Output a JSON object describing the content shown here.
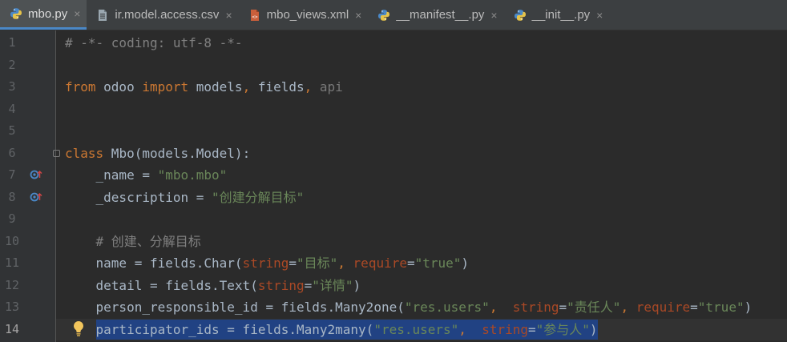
{
  "tabs": [
    {
      "label": "mbo.py",
      "icon": "python-file-icon",
      "active": true
    },
    {
      "label": "ir.model.access.csv",
      "icon": "csv-file-icon",
      "active": false
    },
    {
      "label": "mbo_views.xml",
      "icon": "xml-file-icon",
      "active": false
    },
    {
      "label": "__manifest__.py",
      "icon": "python-file-icon",
      "active": false
    },
    {
      "label": "__init__.py",
      "icon": "python-file-icon",
      "active": false
    }
  ],
  "tab_close_glyph": "×",
  "current_line": 14,
  "lines": [
    {
      "n": "1",
      "code": "# -*- coding: utf-8 -*-"
    },
    {
      "n": "2",
      "code": ""
    },
    {
      "n": "3",
      "code": "from odoo import models, fields, api"
    },
    {
      "n": "4",
      "code": ""
    },
    {
      "n": "5",
      "code": ""
    },
    {
      "n": "6",
      "code": "class Mbo(models.Model):"
    },
    {
      "n": "7",
      "code": "    _name = \"mbo.mbo\""
    },
    {
      "n": "8",
      "code": "    _description = \"创建分解目标\""
    },
    {
      "n": "9",
      "code": ""
    },
    {
      "n": "10",
      "code": "    # 创建、分解目标"
    },
    {
      "n": "11",
      "code": "    name = fields.Char(string=\"目标\", require=\"true\")"
    },
    {
      "n": "12",
      "code": "    detail = fields.Text(string=\"详情\")"
    },
    {
      "n": "13",
      "code": "    person_responsible_id = fields.Many2one(\"res.users\",  string=\"责任人\", require=\"true\")"
    },
    {
      "n": "14",
      "code": "    participator_ids = fields.Many2many(\"res.users\",  string=\"参与人\")"
    }
  ],
  "gutter_markers": [
    {
      "line": 7,
      "icon": "override-method-icon"
    },
    {
      "line": 8,
      "icon": "override-method-icon"
    }
  ],
  "intention_bulb_line": 14,
  "colors": {
    "background": "#2b2b2b",
    "keyword": "#cc7832",
    "string": "#6a8759",
    "comment": "#808080",
    "parameter": "#aa4926",
    "selection": "#214283"
  }
}
